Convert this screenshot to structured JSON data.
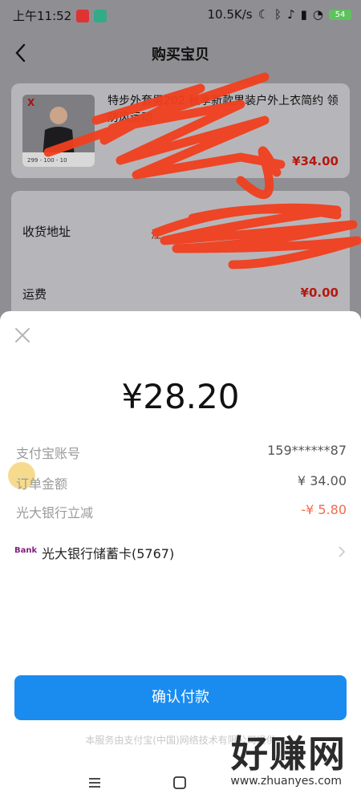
{
  "status_bar": {
    "time": "上午11:52",
    "network_speed": "10.5K/s",
    "battery": "54"
  },
  "header": {
    "title": "购买宝贝"
  },
  "product": {
    "title": "特步外套男202 秋季新款男装户外上衣简约 领防风运动",
    "price": "¥34.00",
    "thumb_text": "299 - 100 - 10"
  },
  "order": {
    "address_label": "收货地址",
    "address_value_partial": "江",
    "shipping_label": "运费",
    "shipping_value": "¥0.00"
  },
  "payment_sheet": {
    "amount": "¥28.20",
    "rows": [
      {
        "label": "支付宝账号",
        "value": "159******87"
      },
      {
        "label": "订单金额",
        "value": "¥ 34.00"
      },
      {
        "label": "光大银行立减",
        "value": "-¥ 5.80"
      }
    ],
    "method_logo": "Bank",
    "method_label": "光大银行储蓄卡(5767)",
    "confirm_label": "确认付款",
    "footer_text": "本服务由支付宝(中国)网络技术有限公司提供"
  },
  "watermark": {
    "big": "好赚网",
    "small": "www.zhuanyes.com"
  },
  "colors": {
    "accent": "#1a8cf0",
    "price_red": "#b7180f",
    "discount_red": "#f06b50"
  }
}
